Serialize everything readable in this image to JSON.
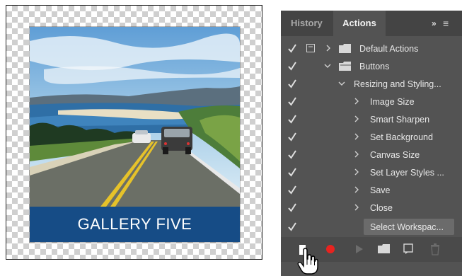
{
  "canvas": {
    "banner_text": "GALLERY FIVE"
  },
  "panel": {
    "tabs": [
      {
        "label": "History"
      },
      {
        "label": "Actions"
      }
    ],
    "expand_glyph": "»",
    "menu_glyph": "≡",
    "rows": [
      {
        "label": "Default Actions"
      },
      {
        "label": "Buttons"
      },
      {
        "label": "Resizing and Styling..."
      },
      {
        "label": "Image Size"
      },
      {
        "label": "Smart Sharpen"
      },
      {
        "label": "Set Background"
      },
      {
        "label": "Canvas Size"
      },
      {
        "label": "Set Layer Styles ..."
      },
      {
        "label": "Save"
      },
      {
        "label": "Close"
      },
      {
        "label": "Select Workspac..."
      }
    ],
    "toolbar": {
      "icons": [
        "stop-icon",
        "record-icon",
        "play-icon",
        "new-set-icon",
        "new-action-icon",
        "trash-icon"
      ]
    }
  },
  "colors": {
    "panel_bg": "#535353",
    "record_red": "#e8231f",
    "banner_blue": "#164c86"
  }
}
